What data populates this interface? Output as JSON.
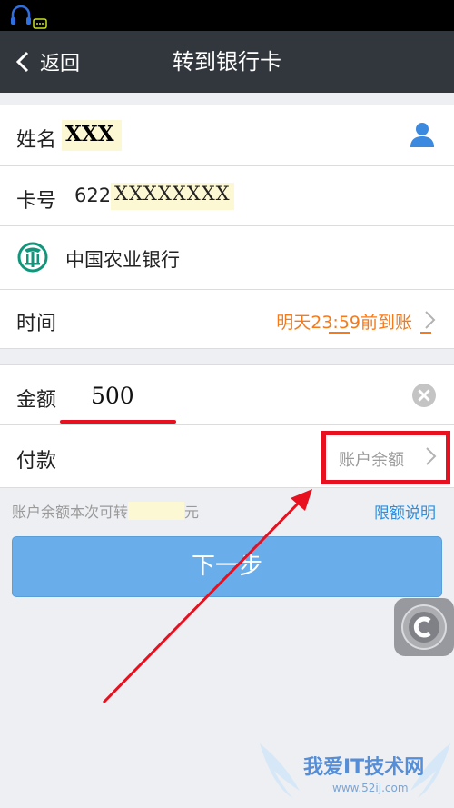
{
  "nav": {
    "back_label": "返回",
    "title": "转到银行卡"
  },
  "form": {
    "name_label": "姓名",
    "name_value": "XXX",
    "card_label": "卡号",
    "card_value_prefix": "622",
    "card_value_masked": "XXXXXXXX",
    "bank_name": "中国农业银行",
    "time_label": "时间",
    "time_value": "明天23:59前到账",
    "amount_label": "金额",
    "amount_value": "500",
    "payment_label": "付款",
    "payment_value": "账户余额"
  },
  "footer": {
    "balance_note_prefix": "账户余额本次可转",
    "balance_note_suffix": "元",
    "limit_link": "限额说明",
    "next_button": "下一步"
  },
  "watermark": {
    "text": "我爱IT技术网",
    "url": "www.52ij.com"
  },
  "colors": {
    "accent_orange": "#f77a1a",
    "link_blue": "#2e8fde",
    "button_blue": "#69aeea",
    "annotation_red": "#e8101e",
    "navbar": "#32373d",
    "bank_green": "#11967b"
  }
}
